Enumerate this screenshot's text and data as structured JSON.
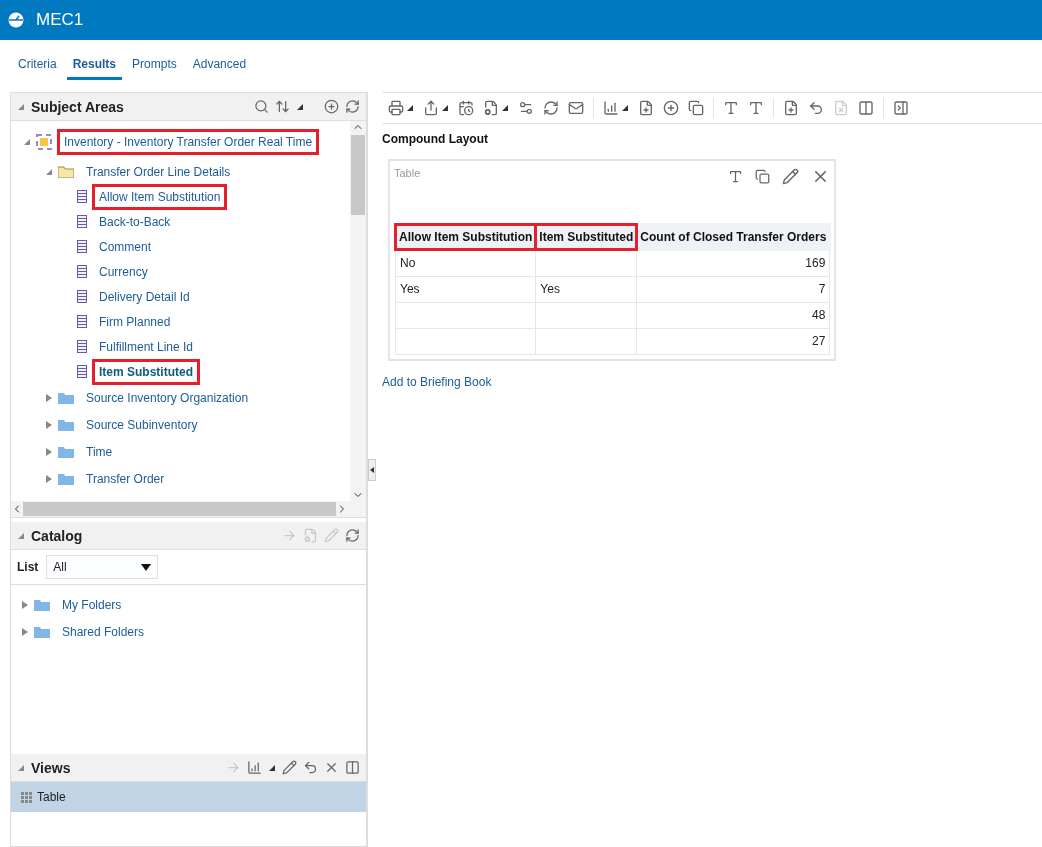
{
  "window": {
    "title": "MEC1"
  },
  "tabs": [
    {
      "label": "Criteria",
      "selected": false
    },
    {
      "label": "Results",
      "selected": true
    },
    {
      "label": "Prompts",
      "selected": false
    },
    {
      "label": "Advanced",
      "selected": false
    }
  ],
  "subject_areas": {
    "title": "Subject Areas",
    "expanded": true,
    "tree": [
      {
        "kind": "subject",
        "label": "Inventory - Inventory Transfer Order Real Time",
        "expanded": true,
        "highlighted": true,
        "selected": false,
        "children": [
          {
            "kind": "folder",
            "label": "Transfer Order Line Details",
            "expanded": true,
            "highlighted": false,
            "selected": false,
            "children": [
              {
                "kind": "column",
                "label": "Allow Item Substitution",
                "highlighted": true,
                "selected": false
              },
              {
                "kind": "column",
                "label": "Back-to-Back",
                "highlighted": false,
                "selected": false
              },
              {
                "kind": "column",
                "label": "Comment",
                "highlighted": false,
                "selected": false
              },
              {
                "kind": "column",
                "label": "Currency",
                "highlighted": false,
                "selected": false
              },
              {
                "kind": "column",
                "label": "Delivery Detail Id",
                "highlighted": false,
                "selected": false
              },
              {
                "kind": "column",
                "label": "Firm Planned",
                "highlighted": false,
                "selected": false
              },
              {
                "kind": "column",
                "label": "Fulfillment Line Id",
                "highlighted": false,
                "selected": false
              },
              {
                "kind": "column",
                "label": "Item Substituted",
                "highlighted": true,
                "selected": true
              }
            ]
          },
          {
            "kind": "group",
            "label": "Source Inventory Organization",
            "expanded": false,
            "highlighted": false,
            "selected": false
          },
          {
            "kind": "group",
            "label": "Source Subinventory",
            "expanded": false,
            "highlighted": false,
            "selected": false
          },
          {
            "kind": "group",
            "label": "Time",
            "expanded": false,
            "highlighted": false,
            "selected": false
          },
          {
            "kind": "group",
            "label": "Transfer Order",
            "expanded": false,
            "highlighted": false,
            "selected": false
          }
        ]
      }
    ]
  },
  "catalog": {
    "title": "Catalog",
    "expanded": true,
    "list_label": "List",
    "list_value": "All",
    "items": [
      {
        "label": "My Folders",
        "expanded": false
      },
      {
        "label": "Shared Folders",
        "expanded": false
      }
    ]
  },
  "views": {
    "title": "Views",
    "expanded": true,
    "items": [
      {
        "label": "Table",
        "selected": true
      }
    ]
  },
  "results": {
    "layout_title": "Compound Layout",
    "view_title": "Table",
    "columns": [
      {
        "label": "Allow Item Substitution",
        "highlighted": true
      },
      {
        "label": "Item Substituted",
        "highlighted": true
      },
      {
        "label": "Count of Closed Transfer Orders",
        "highlighted": false
      }
    ],
    "rows": [
      {
        "cells": [
          "No",
          null,
          "169"
        ]
      },
      {
        "cells": [
          "Yes",
          "Yes",
          "7"
        ]
      },
      {
        "cells": [
          null,
          null,
          "48"
        ]
      },
      {
        "cells": [
          null,
          null,
          "27"
        ]
      }
    ],
    "link": "Add to Briefing Book"
  }
}
